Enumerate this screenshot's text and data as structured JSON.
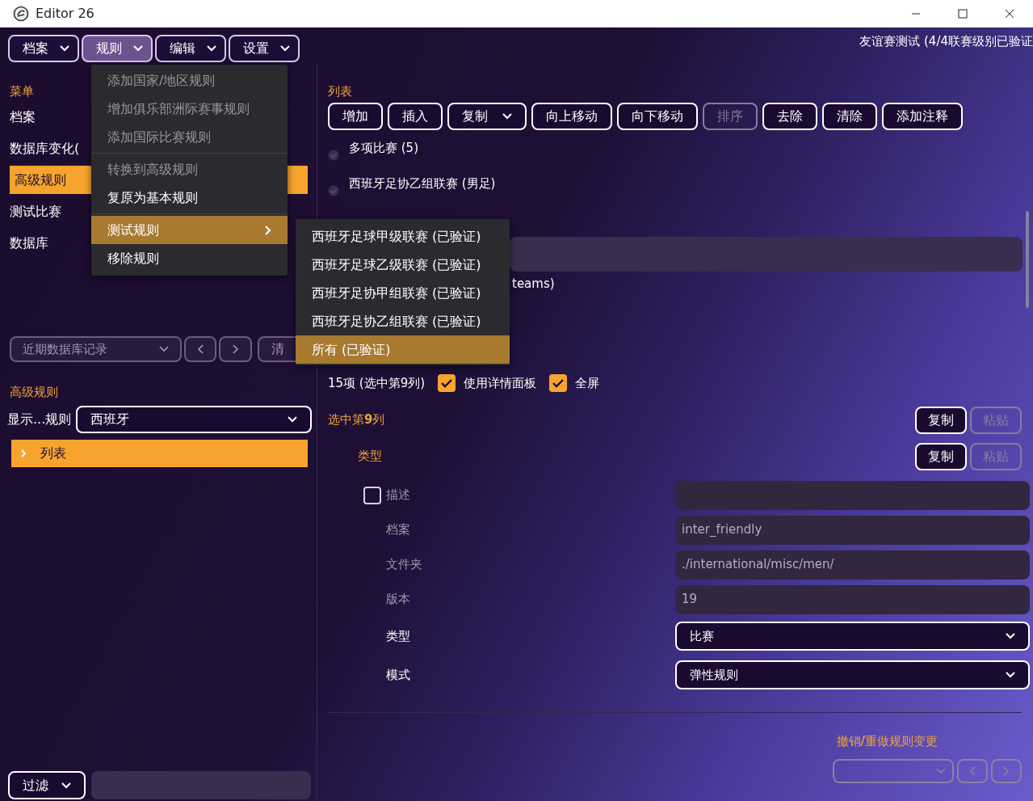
{
  "window": {
    "title": "Editor 26"
  },
  "menu_bar": [
    {
      "label": "档案",
      "selected": false
    },
    {
      "label": "规则",
      "selected": true
    },
    {
      "label": "编辑",
      "selected": false
    },
    {
      "label": "设置",
      "selected": false
    }
  ],
  "header_status": "友谊赛测试 (4/4联赛级别已验证",
  "sidebar": {
    "heading": "菜单",
    "items": [
      {
        "label": "档案",
        "selected": false
      },
      {
        "label": "数据库变化(",
        "selected": false
      },
      {
        "label": "高级规则",
        "selected": true
      },
      {
        "label": "测试比赛",
        "selected": false
      },
      {
        "label": "数据库",
        "selected": false
      }
    ]
  },
  "history": {
    "select": "近期数据库记录",
    "clear_button": "清"
  },
  "rules_panel": {
    "heading": "高级规则",
    "filter_label": "显示...规则",
    "filter_value": "西班牙",
    "tree": [
      {
        "label": "列表",
        "selected": true,
        "expanded": false
      }
    ]
  },
  "filter_bar": {
    "select": "过滤"
  },
  "rules_menu": {
    "groups": [
      [
        {
          "label": "添加国家/地区规则",
          "disabled": true,
          "selected": false,
          "submenu": false
        },
        {
          "label": "增加俱乐部洲际赛事规则",
          "disabled": true,
          "selected": false,
          "submenu": false
        },
        {
          "label": "添加国际比赛规则",
          "disabled": true,
          "selected": false,
          "submenu": false
        }
      ],
      [
        {
          "label": "转换到高级规则",
          "disabled": true,
          "selected": false,
          "submenu": false
        },
        {
          "label": "复原为基本规则",
          "disabled": false,
          "selected": false,
          "submenu": false
        }
      ],
      [
        {
          "label": "测试规则",
          "disabled": false,
          "selected": true,
          "submenu": true
        },
        {
          "label": "移除规则",
          "disabled": false,
          "selected": false,
          "submenu": false
        }
      ]
    ],
    "submenu_items": [
      {
        "label": "西班牙足球甲级联赛 (已验证)",
        "selected": false
      },
      {
        "label": "西班牙足球乙级联赛 (已验证)",
        "selected": false
      },
      {
        "label": "西班牙足协甲组联赛 (已验证)",
        "selected": false
      },
      {
        "label": "西班牙足协乙组联赛 (已验证)",
        "selected": false
      },
      {
        "label": "所有 (已验证)",
        "selected": true
      }
    ]
  },
  "list": {
    "heading": "列表",
    "toolbar": [
      {
        "label": "增加",
        "disabled": false,
        "dropdown": false
      },
      {
        "label": "插入",
        "disabled": false,
        "dropdown": false
      },
      {
        "label": "复制",
        "disabled": false,
        "dropdown": true
      },
      {
        "label": "向上移动",
        "disabled": false,
        "dropdown": false
      },
      {
        "label": "向下移动",
        "disabled": false,
        "dropdown": false
      },
      {
        "label": "排序",
        "disabled": true,
        "dropdown": false
      },
      {
        "label": "去除",
        "disabled": false,
        "dropdown": false
      },
      {
        "label": "清除",
        "disabled": false,
        "dropdown": false
      },
      {
        "label": "添加注释",
        "disabled": false,
        "dropdown": false
      }
    ],
    "rows": [
      {
        "label": "多项比赛 (5)"
      },
      {
        "label": "西班牙足协乙组联赛 (男足)"
      }
    ],
    "covered_row_text": "teams)"
  },
  "options": {
    "count": "15项 (选中第9列)",
    "toggles": [
      {
        "label": "使用详情面板",
        "checked": true
      },
      {
        "label": "全屏",
        "checked": true
      }
    ]
  },
  "clipboard_rows": [
    {
      "heading": "选中第**9**列",
      "kind": "section",
      "buttons": [
        {
          "label": "复制",
          "disabled": false
        },
        {
          "label": "粘贴",
          "disabled": true
        }
      ]
    },
    {
      "heading": "类型",
      "kind": "subsection",
      "buttons": [
        {
          "label": "复制",
          "disabled": false
        },
        {
          "label": "粘贴",
          "disabled": true
        }
      ]
    }
  ],
  "properties": [
    {
      "label": "描述",
      "kind": "checkbox-text",
      "checked": false,
      "disabled": true
    },
    {
      "label": "档案",
      "kind": "text",
      "disabled": true,
      "value": "inter_friendly"
    },
    {
      "label": "文件夹",
      "kind": "text",
      "disabled": true,
      "value": "./international/misc/men/"
    },
    {
      "label": "版本",
      "kind": "text",
      "disabled": true,
      "value": "19"
    },
    {
      "label": "类型",
      "kind": "select",
      "disabled": false,
      "value": "比赛"
    },
    {
      "label": "模式",
      "kind": "select",
      "disabled": false,
      "value": "弹性规则"
    }
  ],
  "undo": {
    "heading": "撤销**/**重做规则变更"
  }
}
